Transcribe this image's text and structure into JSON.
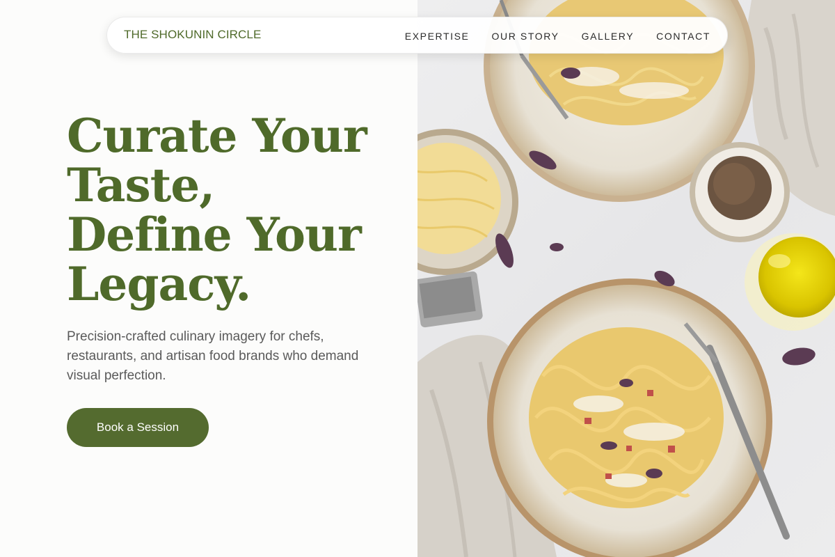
{
  "header": {
    "brand": "THE SHOKUNIN CIRCLE",
    "nav": [
      {
        "label": "EXPERTISE"
      },
      {
        "label": "OUR STORY"
      },
      {
        "label": "GALLERY"
      },
      {
        "label": "CONTACT"
      }
    ]
  },
  "hero": {
    "title_lines": [
      "Curate Your",
      "Taste,",
      "Define Your",
      "Legacy."
    ],
    "subtitle": "Precision-crafted culinary imagery for chefs, restaurants, and artisan food brands who demand visual perfection.",
    "cta_label": "Book a Session"
  },
  "image": {
    "subject": "overhead photo of pasta dishes with parmesan, spices, olive oil and linen napkins"
  },
  "colors": {
    "brand_green": "#4f6a2a",
    "button_green": "#546b2f",
    "text_gray": "#5a5a5a"
  }
}
